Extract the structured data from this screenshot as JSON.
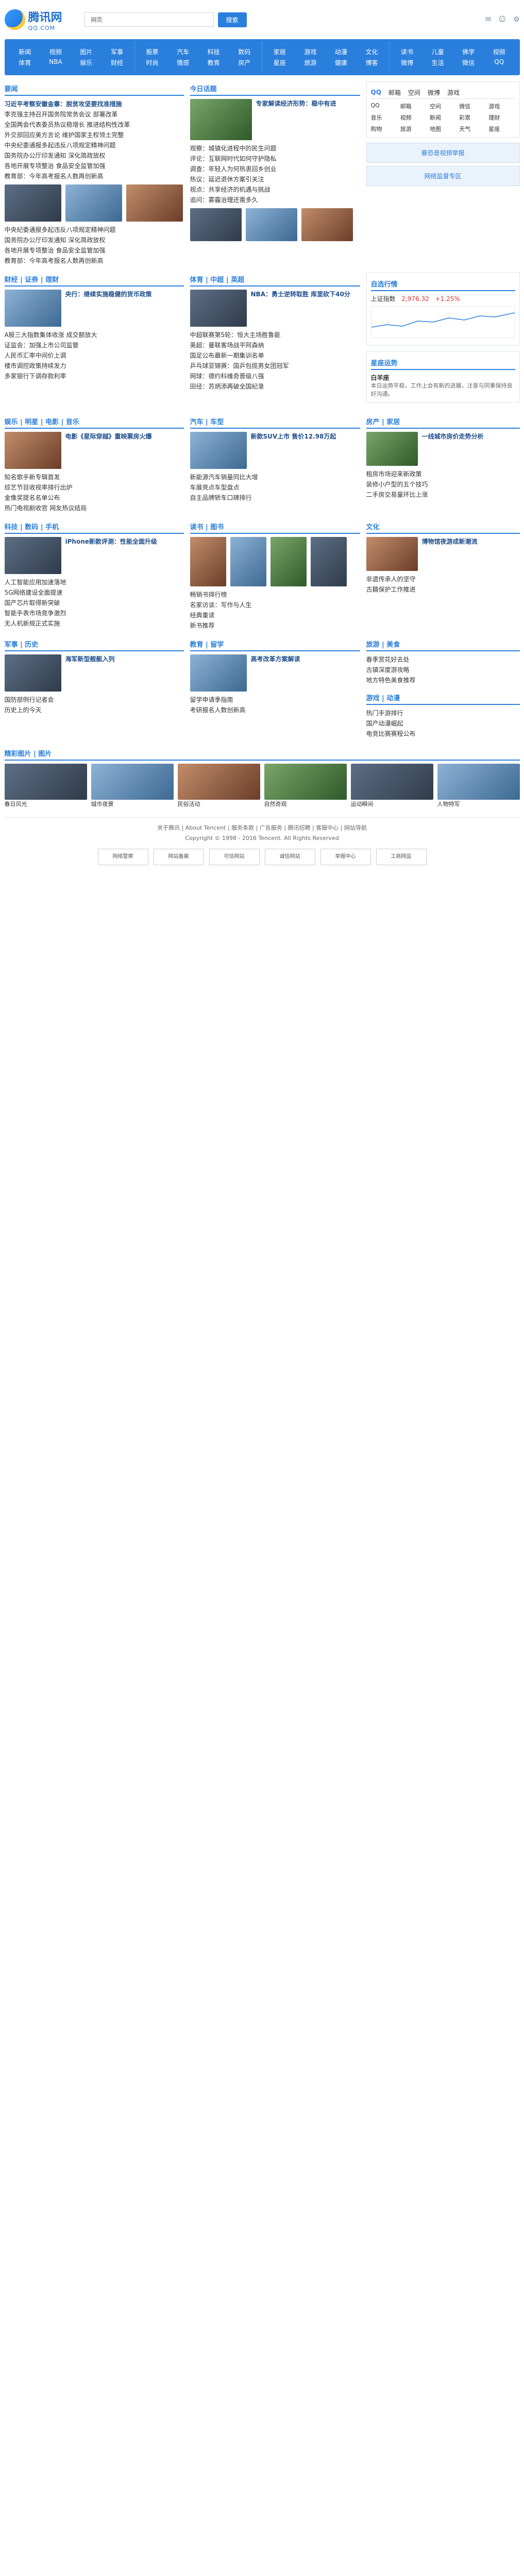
{
  "header": {
    "logo_text": "腾讯网",
    "logo_sub": "QQ.COM",
    "search_scope": "网页",
    "search_placeholder": "",
    "search_button": "搜索",
    "tools": [
      "✉",
      "☺",
      "⚙"
    ]
  },
  "nav": [
    [
      "新闻",
      "视频",
      "图片",
      "军事",
      "体育",
      "NBA",
      "娱乐",
      "财经"
    ],
    [
      "股票",
      "汽车",
      "科技",
      "数码",
      "时尚",
      "情感",
      "教育",
      "房产"
    ],
    [
      "家居",
      "游戏",
      "动漫",
      "文化",
      "星座",
      "旅游",
      "健康",
      "博客"
    ],
    [
      "读书",
      "儿童",
      "佛学",
      "视频",
      "微博",
      "生活",
      "微信",
      "QQ"
    ]
  ],
  "news": {
    "title": "要闻",
    "items": [
      {
        "t": "习近平考察安徽金寨：脱贫攻坚要找准措施",
        "hl": true
      },
      {
        "t": "李克强主持召开国务院常务会议 部署改革",
        "hl": false
      },
      {
        "t": "全国两会代表委员热议稳增长 推进结构性改革",
        "hl": false
      },
      {
        "t": "外交部回应美方言论 维护国家主权领土完整",
        "hl": false
      },
      {
        "t": "中央纪委通报多起违反八项规定精神问题",
        "hl": false
      },
      {
        "t": "国务院办公厅印发通知 深化简政放权",
        "hl": false
      },
      {
        "t": "各地开展专项整治 食品安全监管加强",
        "hl": false
      },
      {
        "t": "教育部：今年高考报名人数再创新高",
        "hl": false
      }
    ]
  },
  "today": {
    "title": "今日话题",
    "feature_title": "专家解读经济形势：稳中有进",
    "items": [
      "观察：城镇化进程中的民生问题",
      "评论：互联网时代如何守护隐私",
      "调查：年轻人为何热衷回乡创业",
      "热议：延迟退休方案引关注",
      "视点：共享经济的机遇与挑战",
      "追问：雾霾治理还需多久"
    ]
  },
  "services": {
    "tabs": [
      "QQ",
      "邮箱",
      "空间",
      "微博",
      "游戏"
    ],
    "items": [
      "QQ",
      "邮箱",
      "空间",
      "微信",
      "游戏",
      "音乐",
      "视频",
      "新闻",
      "彩票",
      "理财",
      "购物",
      "旅游",
      "地图",
      "天气",
      "星座"
    ],
    "ad1": "暴恐音视频举报",
    "ad2": "网络监督专区"
  },
  "finance": {
    "title": "财经 | 证券 | 理财",
    "items": [
      "央行：继续实施稳健的货币政策",
      "A股三大指数集体收涨 成交额放大",
      "证监会：加强上市公司监管",
      "人民币汇率中间价上调",
      "楼市调控政策持续发力",
      "多家银行下调存款利率"
    ]
  },
  "stock": {
    "title": "自选行情",
    "index_name": "上证指数",
    "index_value": "2,976.32",
    "change": "+1.25%"
  },
  "astro": {
    "title": "星座运势",
    "sign": "白羊座",
    "text": "本日运势平稳，工作上会有新的进展，注意与同事保持良好沟通。"
  },
  "sports": {
    "title": "体育 | 中超 | 英超",
    "feature": "NBA：勇士逆转取胜 库里砍下40分",
    "items": [
      "中超联赛第5轮：恒大主场胜鲁能",
      "英超：曼联客场战平阿森纳",
      "国足公布最新一期集训名单",
      "乒乓球亚锦赛：国乒包揽男女团冠军",
      "网球：德约科维奇晋级八强",
      "田径：苏炳添再破全国纪录"
    ]
  },
  "auto": {
    "title": "汽车 | 车型",
    "items": [
      "新款SUV上市 售价12.98万起",
      "新能源汽车销量同比大增",
      "车展亮点车型盘点",
      "自主品牌轿车口碑排行"
    ]
  },
  "house": {
    "title": "房产 | 家居",
    "items": [
      "一线城市房价走势分析",
      "租房市场迎来新政策",
      "装修小户型的五个技巧",
      "二手房交易量环比上涨"
    ]
  },
  "ent": {
    "title": "娱乐 | 明星 | 电影 | 音乐",
    "items": [
      "电影《星际穿越》重映票房火爆",
      "知名歌手新专辑首发",
      "综艺节目收视率排行出炉",
      "金像奖提名名单公布",
      "热门电视剧收官 网友热议结局"
    ]
  },
  "book": {
    "title": "读书 | 图书",
    "items": [
      "畅销书排行榜",
      "名家访谈：写作与人生",
      "经典重读",
      "新书推荐"
    ]
  },
  "tech": {
    "title": "科技 | 数码 | 手机",
    "feature": "iPhone新款评测：性能全面升级",
    "items": [
      "人工智能应用加速落地",
      "5G网络建设全面提速",
      "国产芯片取得新突破",
      "智能手表市场竞争激烈",
      "无人机新规正式实施"
    ]
  },
  "culture": {
    "title": "文化",
    "items": [
      "博物馆夜游成新潮流",
      "非遗传承人的坚守",
      "古籍保护工作推进"
    ]
  },
  "military": {
    "title": "军事 | 历史",
    "items": [
      "海军新型舰艇入列",
      "国防部例行记者会",
      "历史上的今天"
    ]
  },
  "edu": {
    "title": "教育 | 留学",
    "items": [
      "高考改革方案解读",
      "留学申请季指南",
      "考研报名人数创新高"
    ]
  },
  "travel": {
    "title": "旅游 | 美食",
    "items": [
      "春季赏花好去处",
      "古镇深度游攻略",
      "地方特色美食推荐"
    ]
  },
  "game": {
    "title": "游戏 | 动漫",
    "items": [
      "热门手游排行",
      "国产动漫崛起",
      "电竞比赛赛程公布"
    ]
  },
  "gallery": {
    "title": "精彩图片 | 图片",
    "caps": [
      "春日风光",
      "城市夜景",
      "民俗活动",
      "自然奇观",
      "运动瞬间",
      "人物特写"
    ]
  },
  "footer": {
    "links": "关于腾讯 | About Tencent | 服务条款 | 广告服务 | 腾讯招聘 | 客服中心 | 网站导航",
    "copyright": "Copyright © 1998 - 2016 Tencent. All Rights Reserved",
    "badges": [
      "网络警察",
      "网站备案",
      "可信网站",
      "诚信网站",
      "举报中心",
      "工商网监"
    ]
  }
}
